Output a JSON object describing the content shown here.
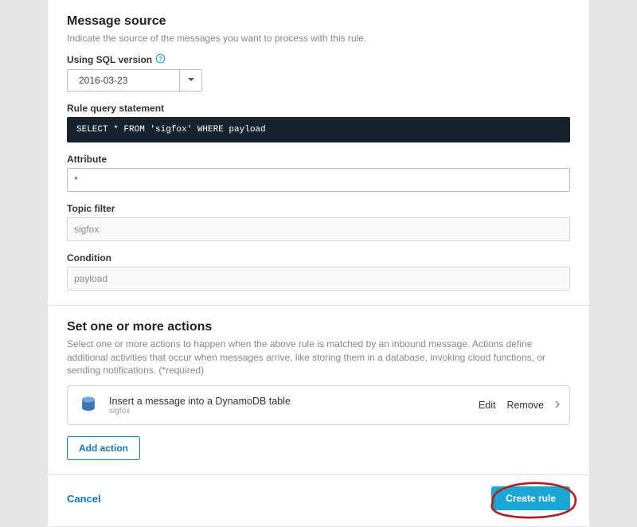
{
  "messageSource": {
    "title": "Message source",
    "description": "Indicate the source of the messages you want to process with this rule.",
    "sqlVersionLabel": "Using SQL version",
    "sqlVersionValue": "2016-03-23",
    "ruleQueryLabel": "Rule query statement",
    "ruleQueryValue": "SELECT * FROM 'sigfox' WHERE payload",
    "attributeLabel": "Attribute",
    "attributeValue": "*",
    "topicFilterLabel": "Topic filter",
    "topicFilterValue": "sigfox",
    "conditionLabel": "Condition",
    "conditionValue": "payload"
  },
  "actionsSection": {
    "title": "Set one or more actions",
    "description": "Select one or more actions to happen when the above rule is matched by an inbound message. Actions define additional activities that occur when messages arrive, like storing them in a database, invoking cloud functions, or sending notifications. (*required)",
    "action": {
      "title": "Insert a message into a DynamoDB table",
      "subtitle": "sigfox",
      "editLabel": "Edit",
      "removeLabel": "Remove"
    },
    "addActionLabel": "Add action"
  },
  "footer": {
    "cancelLabel": "Cancel",
    "createLabel": "Create rule"
  },
  "colors": {
    "accent": "#0f7bb5",
    "primaryButton": "#1aa7d6",
    "codeBg": "#15232f"
  }
}
